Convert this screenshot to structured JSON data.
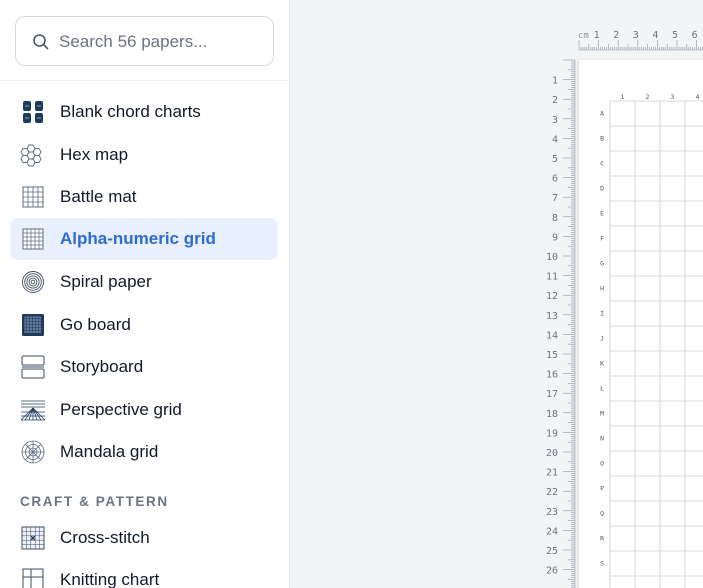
{
  "search": {
    "placeholder": "Search 56 papers..."
  },
  "sidebar": {
    "items": [
      {
        "label": "Blank chord charts",
        "icon": "chord-chart-icon"
      },
      {
        "label": "Hex map",
        "icon": "hex-map-icon"
      },
      {
        "label": "Battle mat",
        "icon": "battle-mat-icon"
      },
      {
        "label": "Alpha-numeric grid",
        "icon": "alphanumeric-grid-icon",
        "active": true
      },
      {
        "label": "Spiral paper",
        "icon": "spiral-icon"
      },
      {
        "label": "Go board",
        "icon": "go-board-icon"
      },
      {
        "label": "Storyboard",
        "icon": "storyboard-icon"
      },
      {
        "label": "Perspective grid",
        "icon": "perspective-grid-icon"
      },
      {
        "label": "Mandala grid",
        "icon": "mandala-grid-icon"
      }
    ],
    "section": "CRAFT & PATTERN",
    "craft_items": [
      {
        "label": "Cross-stitch",
        "icon": "cross-stitch-icon"
      },
      {
        "label": "Knitting chart",
        "icon": "knitting-chart-icon"
      }
    ]
  },
  "ruler": {
    "unit": "cm",
    "top_numbers": [
      "1",
      "2",
      "3",
      "4",
      "5",
      "6"
    ],
    "left_numbers": [
      "1",
      "2",
      "3",
      "4",
      "5",
      "6",
      "7",
      "8",
      "9",
      "10",
      "11",
      "12",
      "13",
      "14",
      "15",
      "16",
      "17",
      "18",
      "19",
      "20",
      "21",
      "22",
      "23",
      "24",
      "25",
      "26"
    ]
  },
  "grid": {
    "columns": [
      "1",
      "2",
      "3",
      "4"
    ],
    "rows": [
      "A",
      "B",
      "C",
      "D",
      "E",
      "F",
      "G",
      "H",
      "I",
      "J",
      "K",
      "L",
      "M",
      "N",
      "O",
      "P",
      "Q",
      "R",
      "S"
    ]
  },
  "colors": {
    "accent": "#2f6bd1",
    "active_bg": "#e8f0fd"
  }
}
